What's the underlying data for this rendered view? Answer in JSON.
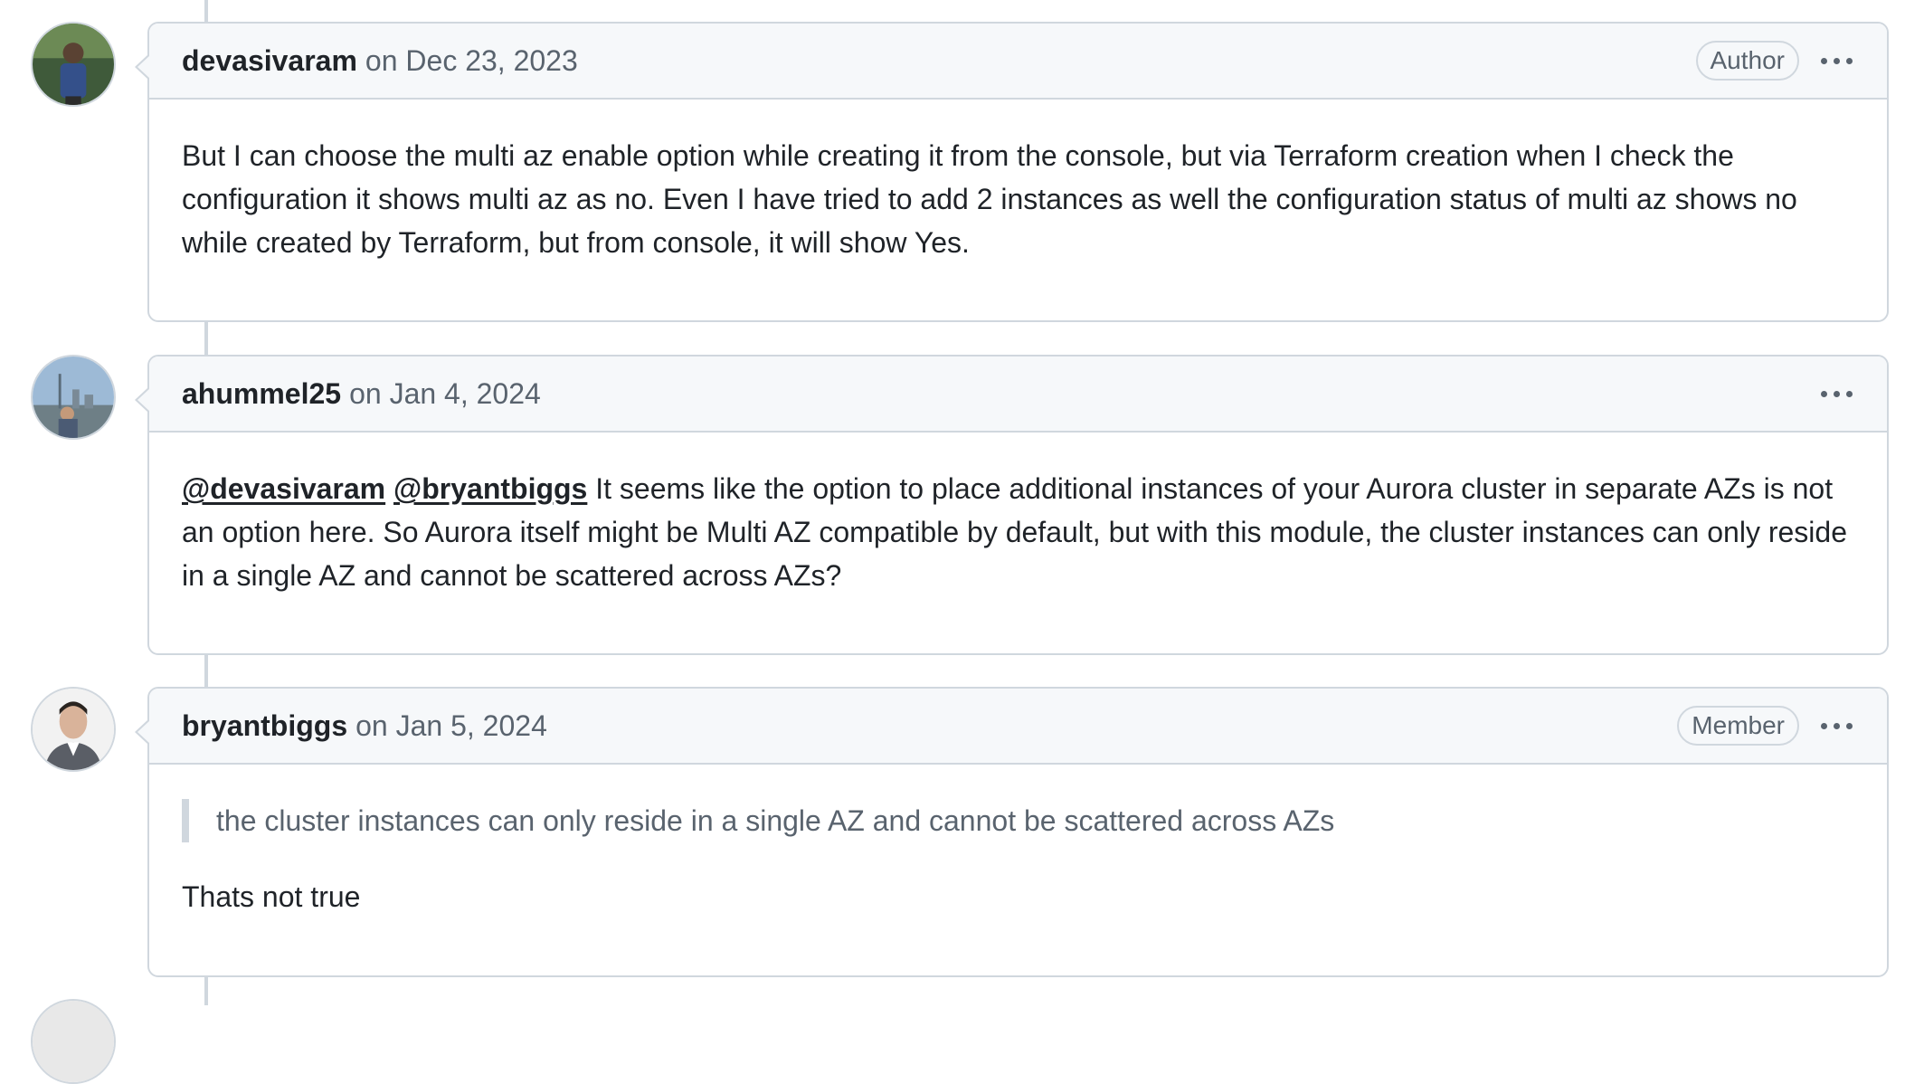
{
  "comments": [
    {
      "author": "devasivaram",
      "date": "on Dec 23, 2023",
      "badge": "Author",
      "avatar_icon": "user-avatar-icon",
      "body": "But I can choose the multi az enable option while creating it from the console, but via Terraform creation when I check the configuration it shows multi az as no. Even I have tried to add 2 instances as well the configuration status of multi az shows no while created by Terraform, but from console, it will show Yes."
    },
    {
      "author": "ahummel25",
      "date": "on Jan 4, 2024",
      "badge": "",
      "avatar_icon": "user-avatar-icon",
      "mentions": [
        "@devasivaram",
        "@bryantbiggs"
      ],
      "body": " It seems like the option to place additional instances of your Aurora cluster in separate AZs is not an option here. So Aurora itself might be Multi AZ compatible by default, but with this module, the cluster instances can only reside in a single AZ and cannot be scattered across AZs?"
    },
    {
      "author": "bryantbiggs",
      "date": "on Jan 5, 2024",
      "badge": "Member",
      "avatar_icon": "user-avatar-icon",
      "quote": "the cluster instances can only reside in a single AZ and cannot be scattered across AZs",
      "body": "Thats not true"
    }
  ],
  "colors": {
    "border": "#d0d7de",
    "header_bg": "#f6f8fa",
    "text": "#1f2328",
    "muted": "#59636e"
  },
  "icons": {
    "more": "kebab-horizontal-icon"
  }
}
